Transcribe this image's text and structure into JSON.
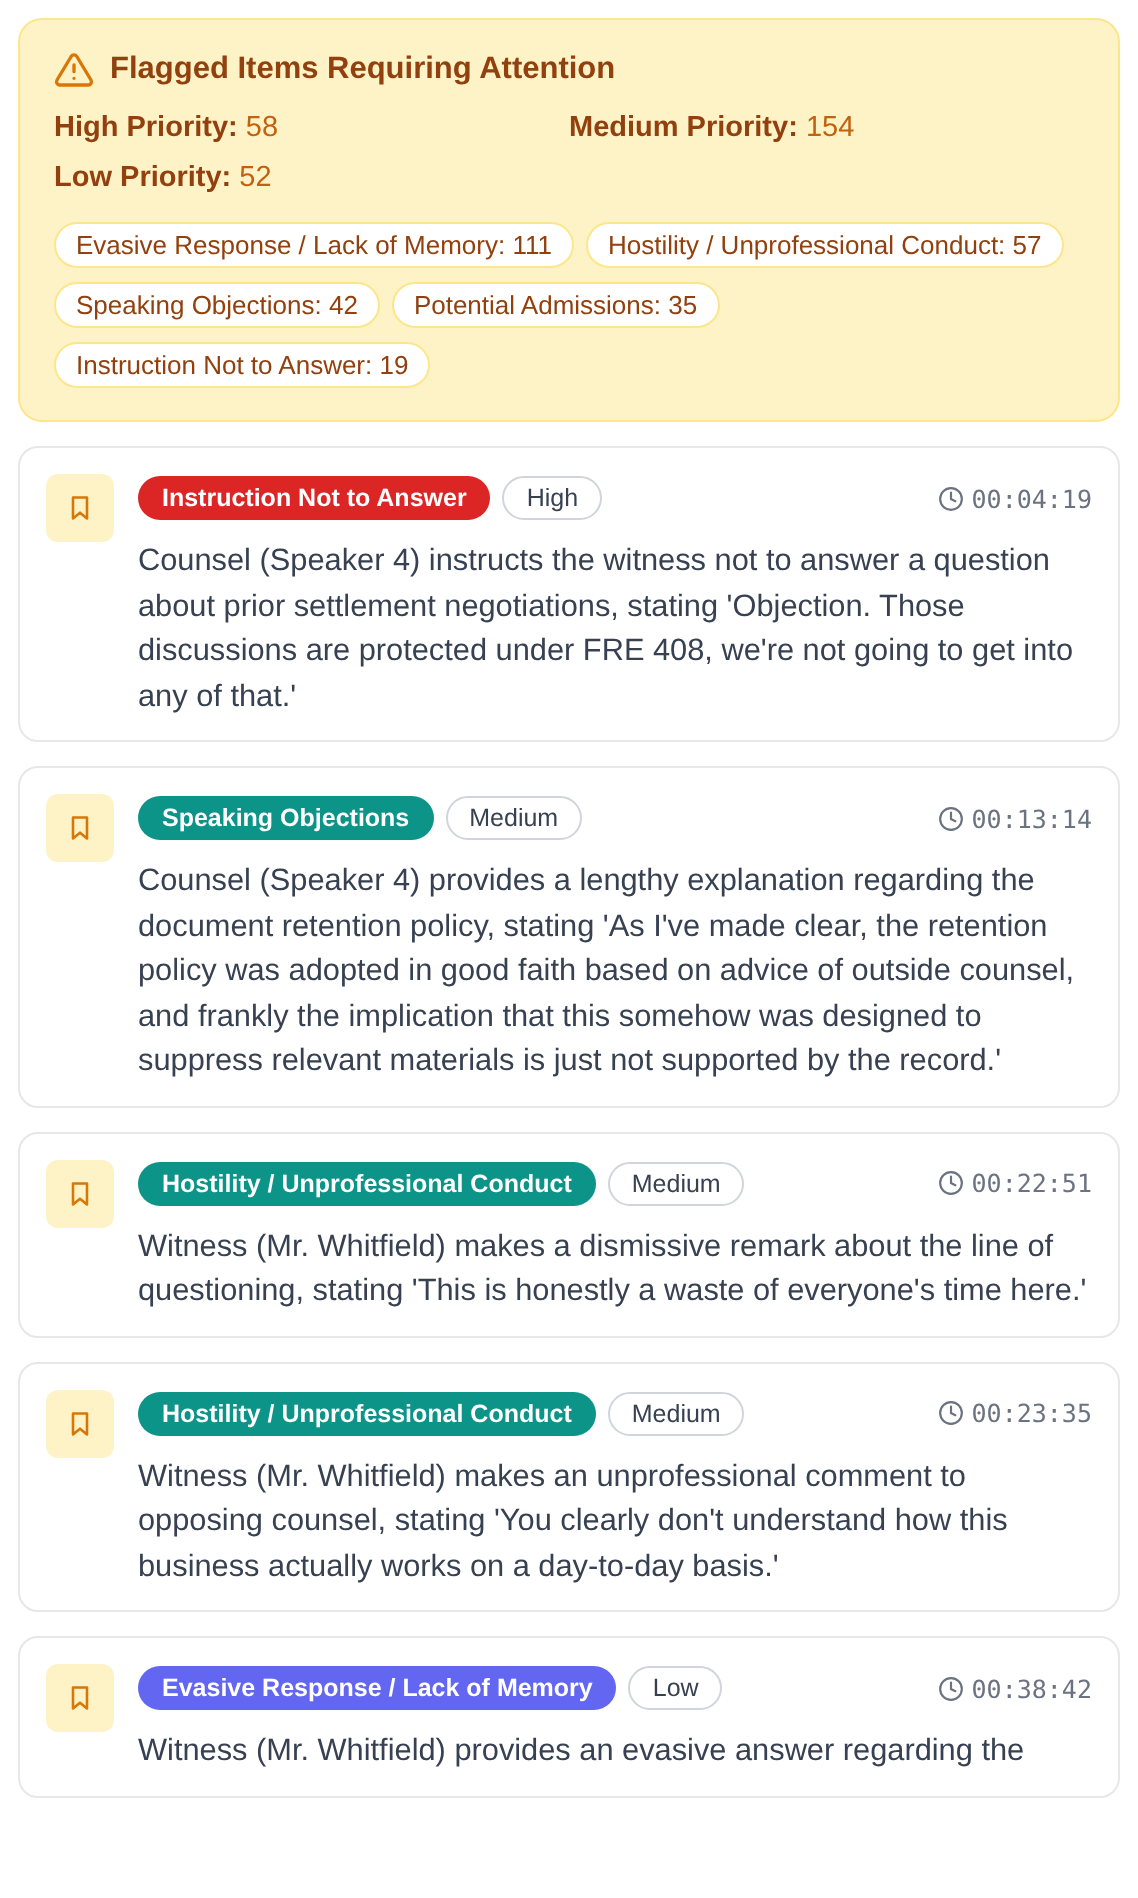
{
  "summary": {
    "title": "Flagged Items Requiring Attention",
    "priorities": [
      {
        "label": "High Priority:",
        "count": "58"
      },
      {
        "label": "Medium Priority:",
        "count": "154"
      },
      {
        "label": "Low Priority:",
        "count": "52"
      }
    ],
    "categories": [
      "Evasive Response / Lack of Memory: 111",
      "Hostility / Unprofessional Conduct: 57",
      "Speaking Objections: 42",
      "Potential Admissions: 35",
      "Instruction Not to Answer: 19"
    ]
  },
  "items": [
    {
      "category": "Instruction Not to Answer",
      "color": "#dc2626",
      "priority": "High",
      "time": "00:04:19",
      "text": "Counsel (Speaker 4) instructs the witness not to answer a question about prior settlement negotiations, stating 'Objection. Those discussions are protected under FRE 408, we're not going to get into any of that.'"
    },
    {
      "category": "Speaking Objections",
      "color": "#0d9488",
      "priority": "Medium",
      "time": "00:13:14",
      "text": "Counsel (Speaker 4) provides a lengthy explanation regarding the document retention policy, stating 'As I've made clear, the retention policy was adopted in good faith based on advice of outside counsel, and frankly the implication that this somehow was designed to suppress relevant materials is just not supported by the record.'"
    },
    {
      "category": "Hostility / Unprofessional Conduct",
      "color": "#0d9488",
      "priority": "Medium",
      "time": "00:22:51",
      "text": "Witness (Mr. Whitfield) makes a dismissive remark about the line of questioning, stating 'This is honestly a waste of everyone's time here.'"
    },
    {
      "category": "Hostility / Unprofessional Conduct",
      "color": "#0d9488",
      "priority": "Medium",
      "time": "00:23:35",
      "text": "Witness (Mr. Whitfield) makes an unprofessional comment to opposing counsel, stating 'You clearly don't understand how this business actually works on a day-to-day basis.'"
    },
    {
      "category": "Evasive Response / Lack of Memory",
      "color": "#6366f1",
      "priority": "Low",
      "time": "00:38:42",
      "text": "Witness (Mr. Whitfield) provides an evasive answer regarding the"
    }
  ]
}
